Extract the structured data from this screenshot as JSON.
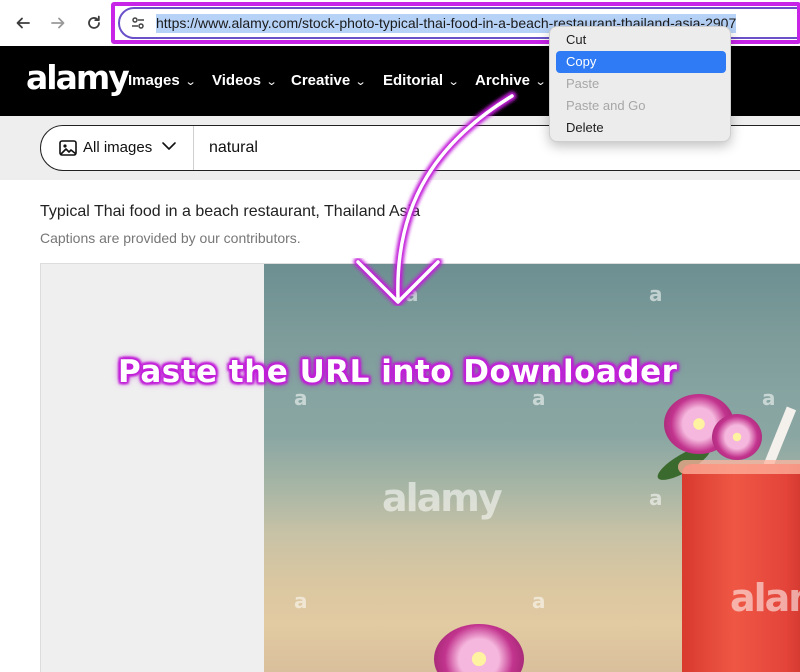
{
  "browser": {
    "url": "https://www.alamy.com/stock-photo-typical-thai-food-in-a-beach-restaurant-thailand-asia-2907"
  },
  "site": {
    "logo": "alamy",
    "nav": [
      "Images",
      "Videos",
      "Creative",
      "Editorial",
      "Archive"
    ]
  },
  "search": {
    "filter_label": "All images",
    "query": "natural"
  },
  "photo": {
    "caption": "Typical Thai food in a beach restaurant, Thailand Asia",
    "credit_note": "Captions are provided by our contributors.",
    "watermark_big": "alamy",
    "watermark_small": "a"
  },
  "context_menu": {
    "items": [
      {
        "label": "Cut",
        "state": "enabled"
      },
      {
        "label": "Copy",
        "state": "highlighted"
      },
      {
        "label": "Paste",
        "state": "disabled"
      },
      {
        "label": "Paste and Go",
        "state": "disabled"
      },
      {
        "label": "Delete",
        "state": "enabled"
      }
    ]
  },
  "annotation": {
    "text": "Paste the URL into Downloader"
  },
  "colors": {
    "annotation_accent": "#c724e8",
    "url_selection": "#b6d2f7",
    "menu_highlight": "#2f7bf5"
  }
}
